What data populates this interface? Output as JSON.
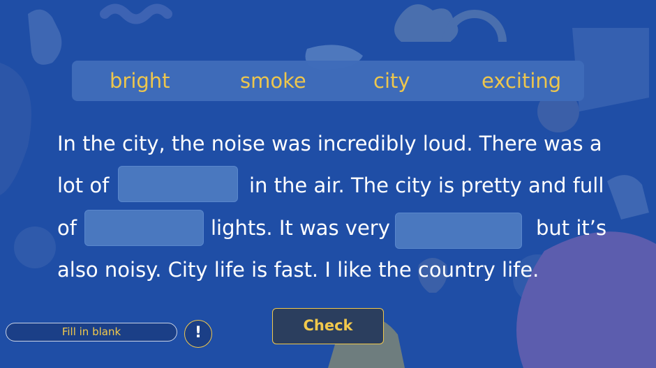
{
  "word_bank": [
    "bright",
    "smoke",
    "city",
    "exciting"
  ],
  "passage": {
    "line1": "In the city, the noise was incredibly loud. There was a",
    "line2_a": "lot of",
    "line2_b": "in the air. The city is pretty and full",
    "line3_a": "of",
    "line3_b": "lights. It was very",
    "line3_c": "but it’s",
    "line4": "also noisy. City life is fast. I like the country life."
  },
  "blanks": [
    {
      "id": 1,
      "value": ""
    },
    {
      "id": 2,
      "value": ""
    },
    {
      "id": 3,
      "value": ""
    }
  ],
  "footer": {
    "mode_label": "Fill in blank",
    "alert_label": "!",
    "check_label": "Check"
  },
  "colors": {
    "background": "#1f4ea6",
    "accent": "#f2c94c",
    "text": "#ffffff"
  }
}
